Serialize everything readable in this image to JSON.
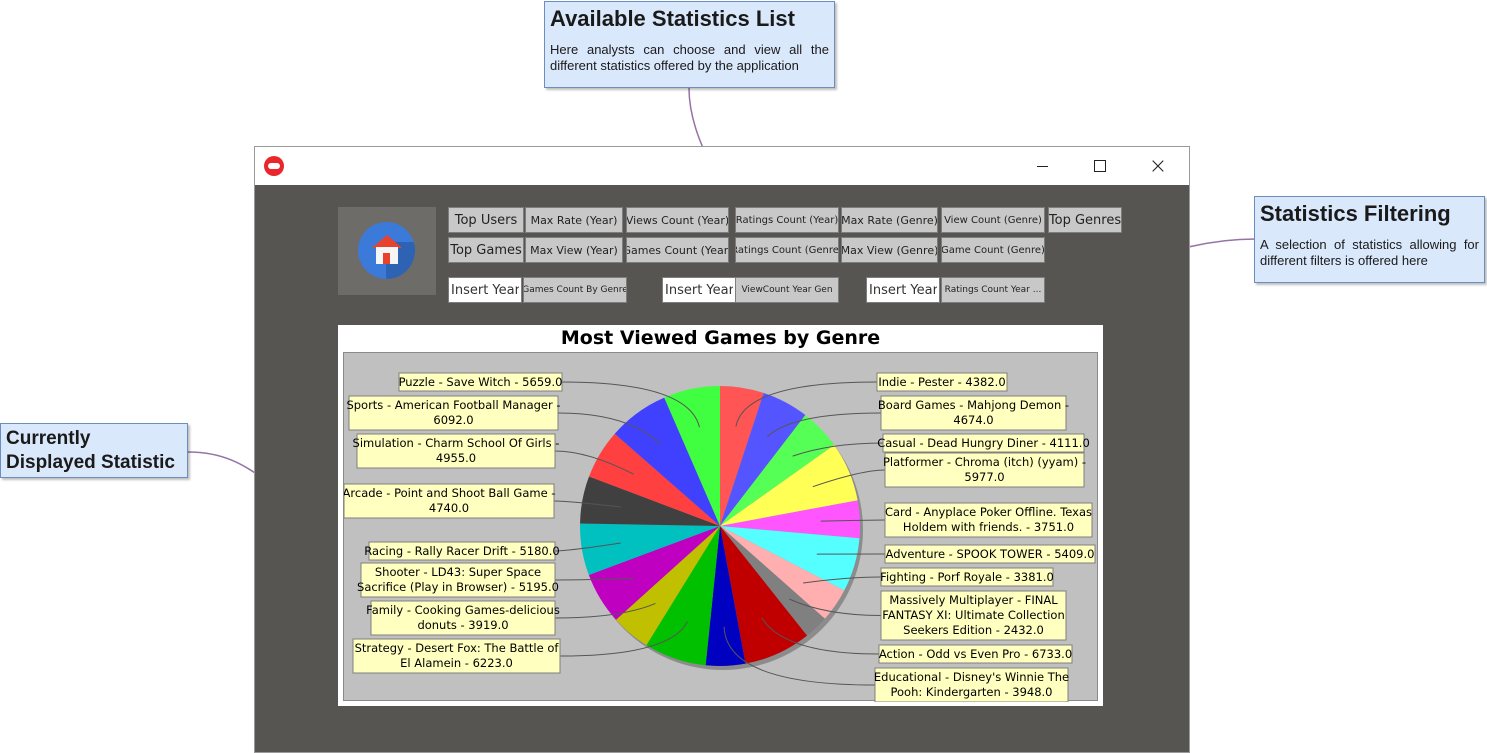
{
  "callouts": {
    "stats_list": {
      "title": "Available Statistics List",
      "body": "Here analysts can choose and view all the different statistics offered by the application"
    },
    "filtering": {
      "title": "Statistics Filtering",
      "body": "A selection of statistics allowing for different filters is offered here"
    },
    "current": {
      "title_line1": "Currently",
      "title_line2": "Displayed Statistic"
    }
  },
  "window": {
    "icon": "gamepad-icon",
    "controls": {
      "minimize": "minimize-icon",
      "maximize": "maximize-icon",
      "close": "×"
    }
  },
  "toolbar": {
    "home_icon": "home-icon",
    "row1": [
      "Top Users",
      "Max Rate (Year)",
      "Views Count (Year)",
      "Ratings Count (Year)",
      "Max Rate (Genre)",
      "View Count (Genre)",
      "Top Genres"
    ],
    "row2": [
      "Top Games",
      "Max View (Year)",
      "Games Count (Year)",
      "Ratings Count (Genre)",
      "Max View (Genre)",
      "Game Count (Genre)"
    ],
    "filters": [
      {
        "placeholder": "Insert Year",
        "button": "Games Count By Genre"
      },
      {
        "placeholder": "Insert Year",
        "button": "ViewCount Year Gen"
      },
      {
        "placeholder": "Insert Year",
        "button": "Ratings Count Year ..."
      }
    ]
  },
  "colors": {
    "background": "#575551",
    "button": "#c8c8c8",
    "callout_fill": "#dae8fc",
    "callout_border": "#6c8ebf",
    "connector": "#9673a6",
    "plot_bg": "#c0c0c0",
    "label_bg": "#ffffc0"
  },
  "chart_data": {
    "type": "pie",
    "title": "Most Viewed Games by Genre",
    "slices": [
      {
        "label": "Indie - Pester - 4382.0",
        "genre": "Indie",
        "game": "Pester",
        "value": 4382.0,
        "color": "#ff5555"
      },
      {
        "label": "Board Games - Mahjong Demon - 4674.0",
        "genre": "Board Games",
        "game": "Mahjong Demon",
        "value": 4674.0,
        "color": "#5555ff"
      },
      {
        "label": "Casual - Dead Hungry Diner - 4111.0",
        "genre": "Casual",
        "game": "Dead Hungry Diner",
        "value": 4111.0,
        "color": "#55ff55"
      },
      {
        "label": "Platformer - Chroma (itch) (yyam) - 5977.0",
        "genre": "Platformer",
        "game": "Chroma (itch) (yyam)",
        "value": 5977.0,
        "color": "#ffff55"
      },
      {
        "label": "Card - Anyplace Poker Offline. Texas Holdem with friends. - 3751.0",
        "genre": "Card",
        "game": "Anyplace Poker Offline. Texas Holdem with friends.",
        "value": 3751.0,
        "color": "#ff55ff"
      },
      {
        "label": "Adventure - SPOOK TOWER - 5409.0",
        "genre": "Adventure",
        "game": "SPOOK TOWER",
        "value": 5409.0,
        "color": "#55ffff"
      },
      {
        "label": "Fighting - Porf Royale - 3381.0",
        "genre": "Fighting",
        "game": "Porf Royale",
        "value": 3381.0,
        "color": "#ffafaf"
      },
      {
        "label": "Massively Multiplayer - FINAL FANTASY XI: Ultimate Collection Seekers Edition - 2432.0",
        "genre": "Massively Multiplayer",
        "game": "FINAL FANTASY XI: Ultimate Collection Seekers Edition",
        "value": 2432.0,
        "color": "#808080"
      },
      {
        "label": "Action - Odd vs Even Pro - 6733.0",
        "genre": "Action",
        "game": "Odd vs Even Pro",
        "value": 6733.0,
        "color": "#c00000"
      },
      {
        "label": "Educational - Disney's Winnie The Pooh: Kindergarten - 3948.0",
        "genre": "Educational",
        "game": "Disney's Winnie The Pooh: Kindergarten",
        "value": 3948.0,
        "color": "#0000c0"
      },
      {
        "label": "Strategy - Desert Fox: The Battle of El Alamein - 6223.0",
        "genre": "Strategy",
        "game": "Desert Fox: The Battle of El Alamein",
        "value": 6223.0,
        "color": "#00c000"
      },
      {
        "label": "Family - Cooking Games-delicious donuts - 3919.0",
        "genre": "Family",
        "game": "Cooking Games-delicious donuts",
        "value": 3919.0,
        "color": "#c0c000"
      },
      {
        "label": "Shooter - LD43: Super Space Sacrifice (Play in Browser) - 5195.0",
        "genre": "Shooter",
        "game": "LD43: Super Space Sacrifice (Play in Browser)",
        "value": 5195.0,
        "color": "#c000c0"
      },
      {
        "label": "Racing - Rally Racer Drift - 5180.0",
        "genre": "Racing",
        "game": "Rally Racer Drift",
        "value": 5180.0,
        "color": "#00c0c0"
      },
      {
        "label": "Arcade - Point and Shoot Ball Game - 4740.0",
        "genre": "Arcade",
        "game": "Point and Shoot Ball Game",
        "value": 4740.0,
        "color": "#404040"
      },
      {
        "label": "Simulation - Charm School Of Girls - 4955.0",
        "genre": "Simulation",
        "game": "Charm School Of Girls",
        "value": 4955.0,
        "color": "#ff4040"
      },
      {
        "label": "Sports - American Football Manager - 6092.0",
        "genre": "Sports",
        "game": "American Football Manager",
        "value": 6092.0,
        "color": "#4040ff"
      },
      {
        "label": "Puzzle - Save Witch - 5659.0",
        "genre": "Puzzle",
        "game": "Save Witch",
        "value": 5659.0,
        "color": "#40ff40"
      }
    ]
  }
}
